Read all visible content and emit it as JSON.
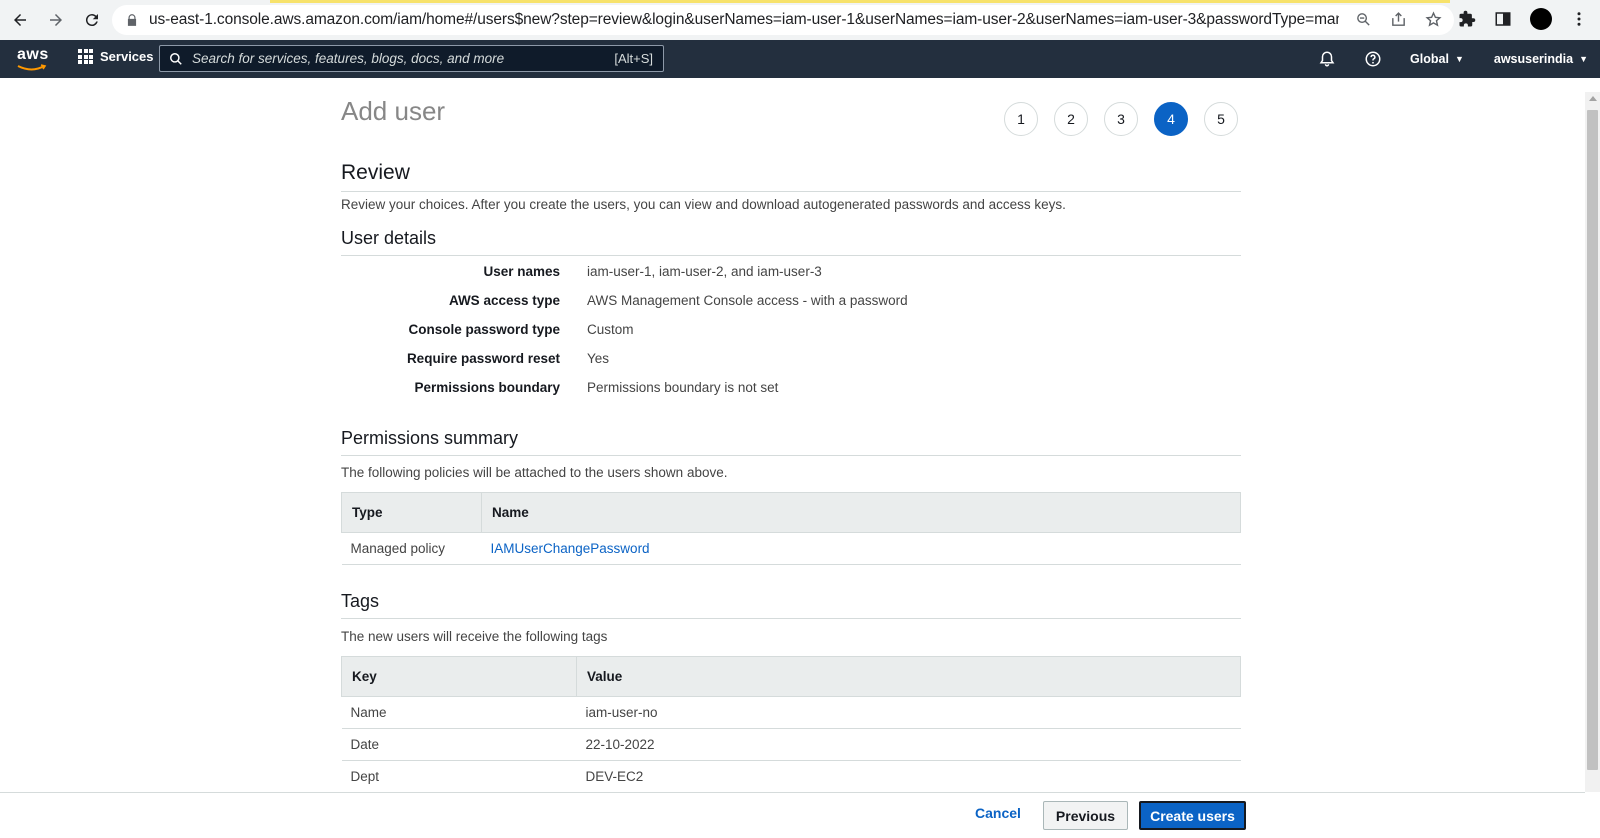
{
  "browser": {
    "url": "us-east-1.console.aws.amazon.com/iam/home#/users$new?step=review&login&userNames=iam-user-1&userNames=iam-user-2&userNames=iam-user-3&passwordType=manual&pa..."
  },
  "awsnav": {
    "logo": "aws",
    "services_label": "Services",
    "search_placeholder": "Search for services, features, blogs, docs, and more",
    "search_shortcut": "[Alt+S]",
    "region": "Global",
    "account": "awsuserindia"
  },
  "page": {
    "title": "Add user",
    "steps": [
      "1",
      "2",
      "3",
      "4",
      "5"
    ],
    "active_step": 4,
    "review_heading": "Review",
    "review_desc": "Review your choices. After you create the users, you can view and download autogenerated passwords and access keys."
  },
  "user_details": {
    "heading": "User details",
    "rows": [
      {
        "label": "User names",
        "value": "iam-user-1, iam-user-2, and iam-user-3"
      },
      {
        "label": "AWS access type",
        "value": "AWS Management Console access - with a password"
      },
      {
        "label": "Console password type",
        "value": "Custom"
      },
      {
        "label": "Require password reset",
        "value": "Yes"
      },
      {
        "label": "Permissions boundary",
        "value": "Permissions boundary is not set"
      }
    ]
  },
  "permissions": {
    "heading": "Permissions summary",
    "desc": "The following policies will be attached to the users shown above.",
    "columns": [
      "Type",
      "Name"
    ],
    "rows": [
      {
        "type": "Managed policy",
        "name": "IAMUserChangePassword"
      }
    ]
  },
  "tags": {
    "heading": "Tags",
    "desc": "The new users will receive the following tags",
    "columns": [
      "Key",
      "Value"
    ],
    "rows": [
      {
        "key": "Name",
        "value": "iam-user-no"
      },
      {
        "key": "Date",
        "value": "22-10-2022"
      },
      {
        "key": "Dept",
        "value": "DEV-EC2"
      }
    ]
  },
  "footer": {
    "cancel": "Cancel",
    "previous": "Previous",
    "create": "Create users"
  },
  "colors": {
    "nav_bg": "#232f3e",
    "primary": "#0b63c5"
  }
}
